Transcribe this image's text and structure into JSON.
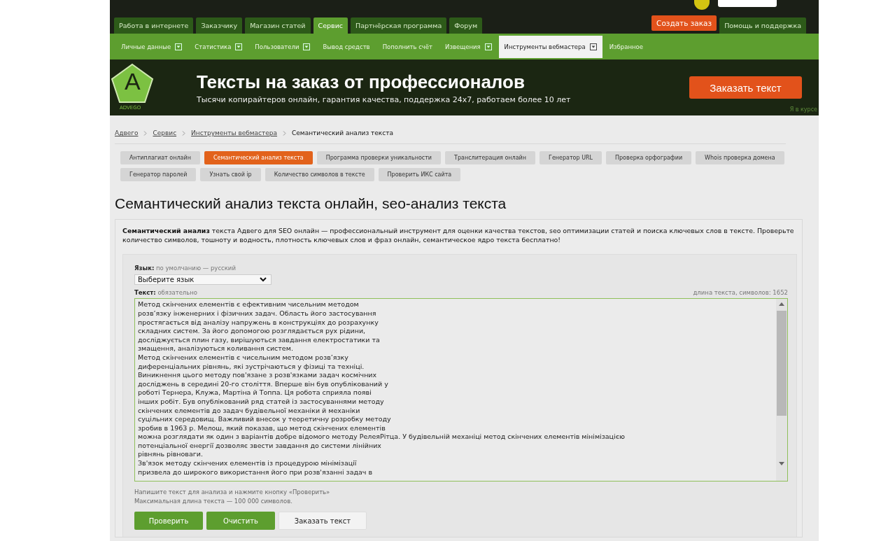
{
  "main_nav": [
    {
      "label": "Работа в интернете",
      "selected": false
    },
    {
      "label": "Заказчику",
      "selected": false
    },
    {
      "label": "Магазин статей",
      "selected": false
    },
    {
      "label": "Сервис",
      "selected": true
    },
    {
      "label": "Партнёрская программа",
      "selected": false
    },
    {
      "label": "Форум",
      "selected": false
    }
  ],
  "create_order_button": "Создать заказ",
  "help_link": "Помощь и поддержка",
  "sub_nav": [
    {
      "label": "Личные данные",
      "dropdown": true,
      "selected": false
    },
    {
      "label": "Статистика",
      "dropdown": true,
      "selected": false
    },
    {
      "label": "Пользователи",
      "dropdown": true,
      "selected": false
    },
    {
      "label": "Вывод средств",
      "dropdown": false,
      "selected": false
    },
    {
      "label": "Пополнить счёт",
      "dropdown": false,
      "selected": false
    },
    {
      "label": "Извещения",
      "dropdown": true,
      "selected": false
    },
    {
      "label": "Инструменты вебмастера",
      "dropdown": true,
      "selected": true
    },
    {
      "label": "Избранное",
      "dropdown": false,
      "selected": false
    }
  ],
  "banner": {
    "logo_letter": "A",
    "logo_text": "ADVEGO",
    "title": "Тексты на заказ от профессионалов",
    "subtitle": "Тысячи копирайтеров онлайн, гарантия качества, поддержка 24x7, работаем более 10 лет",
    "button": "Заказать текст",
    "corner_link": "Я в курсе"
  },
  "breadcrumbs": [
    {
      "label": "Адвего",
      "link": true
    },
    {
      "label": "Сервис",
      "link": true
    },
    {
      "label": "Инструменты вебмастера",
      "link": true
    },
    {
      "label": "Семантический анализ текста",
      "link": false
    }
  ],
  "tool_tabs": [
    {
      "label": "Антиплагиат онлайн",
      "selected": false
    },
    {
      "label": "Семантический анализ текста",
      "selected": true
    },
    {
      "label": "Программа проверки уникальности",
      "selected": false
    },
    {
      "label": "Транслитерация онлайн",
      "selected": false
    },
    {
      "label": "Генератор URL",
      "selected": false
    },
    {
      "label": "Проверка орфографии",
      "selected": false
    },
    {
      "label": "Whois проверка домена",
      "selected": false
    },
    {
      "label": "Генератор паролей",
      "selected": false
    },
    {
      "label": "Узнать свой ip",
      "selected": false
    },
    {
      "label": "Количество символов в тексте",
      "selected": false
    },
    {
      "label": "Проверить ИКС сайта",
      "selected": false
    }
  ],
  "heading": "Семантический анализ текста онлайн, seo-анализ текста",
  "description": "**Семантический анализ** текста Адвего для SEO онлайн — профессиональный инструмент для оценки качества текстов, seo оптимизации статей и поиска ключевых слов в тексте. Проверьте количество символов, тошноту и водность, плотность ключевых слов и фраз онлайн, семантическое ядро текста бесплатно!",
  "form": {
    "language": {
      "label": "Язык:",
      "hint": "по умолчанию — русский",
      "value": "Выберите язык"
    },
    "text": {
      "label": "Текст:",
      "hint": "обязательно",
      "counter": "длина текста, символов: 1652",
      "value": "Метод скінчених елементів є ефективним чисельним методом\nрозв’язку інженерних і фізичних задач. Область його застосування\nпростягається від аналізу напружень в конструкціях до розрахунку\nскладних систем. За його допомогою розглядається рух рідини,\nдосліджується плин газу, вирішуються завдання електростатики та\nзмащення, аналізуються коливання систем.\nМетод скінчених елементів є чисельним методом розв’язку\nдиференціальних рівнянь, які зустрічаються у фізиці та техніці.\nВиникнення цього методу пов'язане з розв'язками задач космічних\nдосліджень в середині 20-го століття. Вперше він був опублікований у\nроботі Тернера, Клужа, Мартіна й Топпа. Ця робота сприяла появі\nінших робіт. Був опублікований ряд статей із застосуваннями методу\nскінчених елементів до задач будівельної механіки й механіки\nсуцільних середовищ. Важливий внесок у теоретичну розробку методу\nзробив в 1963 р. Мелош, який показав, що метод скінчених елементів\nможна розглядати як один з варіантів добре відомого методу РелеяРітца. У будівельній механіці метод скінчених елементів мінімізацією\nпотенціальної енергії дозволяє звести завдання до системи лінійних\nрівнянь рівноваги.\nЗв'язок методу скінчених елементів із процедурою мінімізації\nпризвела до широкого використання його при розв'язанні задач в"
    },
    "notes": [
      "Напишите текст для анализа и нажмите кнопку «Проверить»",
      "Максимальная длина текста — 100 000 символов."
    ],
    "buttons": [
      {
        "label": "Проверить",
        "kind": "primary"
      },
      {
        "label": "Очистить",
        "kind": "primary"
      },
      {
        "label": "Заказать текст",
        "kind": "secondary"
      }
    ]
  }
}
